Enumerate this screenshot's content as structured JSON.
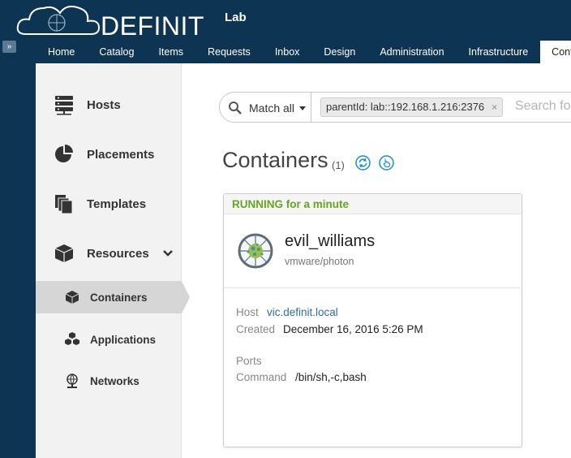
{
  "brand": {
    "name": "DEFINIT",
    "tenant": "Lab"
  },
  "nav": {
    "items": [
      "Home",
      "Catalog",
      "Items",
      "Requests",
      "Inbox",
      "Design",
      "Administration",
      "Infrastructure"
    ],
    "active": "Contair"
  },
  "sidebar": {
    "hosts": "Hosts",
    "placements": "Placements",
    "templates": "Templates",
    "resources": "Resources",
    "containers": "Containers",
    "applications": "Applications",
    "networks": "Networks"
  },
  "search": {
    "match": "Match all",
    "chip": "parentId: lab::192.168.1.216:2376",
    "chip_remove": "×",
    "placeholder": "Search fo"
  },
  "page": {
    "title": "Containers",
    "count": "(1)"
  },
  "card": {
    "status": "RUNNING for a minute",
    "name": "evil_williams",
    "image": "vmware/photon",
    "host_label": "Host",
    "host_value": "vic.definit.local",
    "created_label": "Created",
    "created_value": "December 16, 2016 5:26 PM",
    "ports_label": "Ports",
    "command_label": "Command",
    "command_value": "/bin/sh,-c,bash"
  },
  "colors": {
    "header": "#0e3454",
    "status_green": "#66a51e",
    "link": "#2e6da4",
    "accent_blue": "#1a8fd0"
  }
}
